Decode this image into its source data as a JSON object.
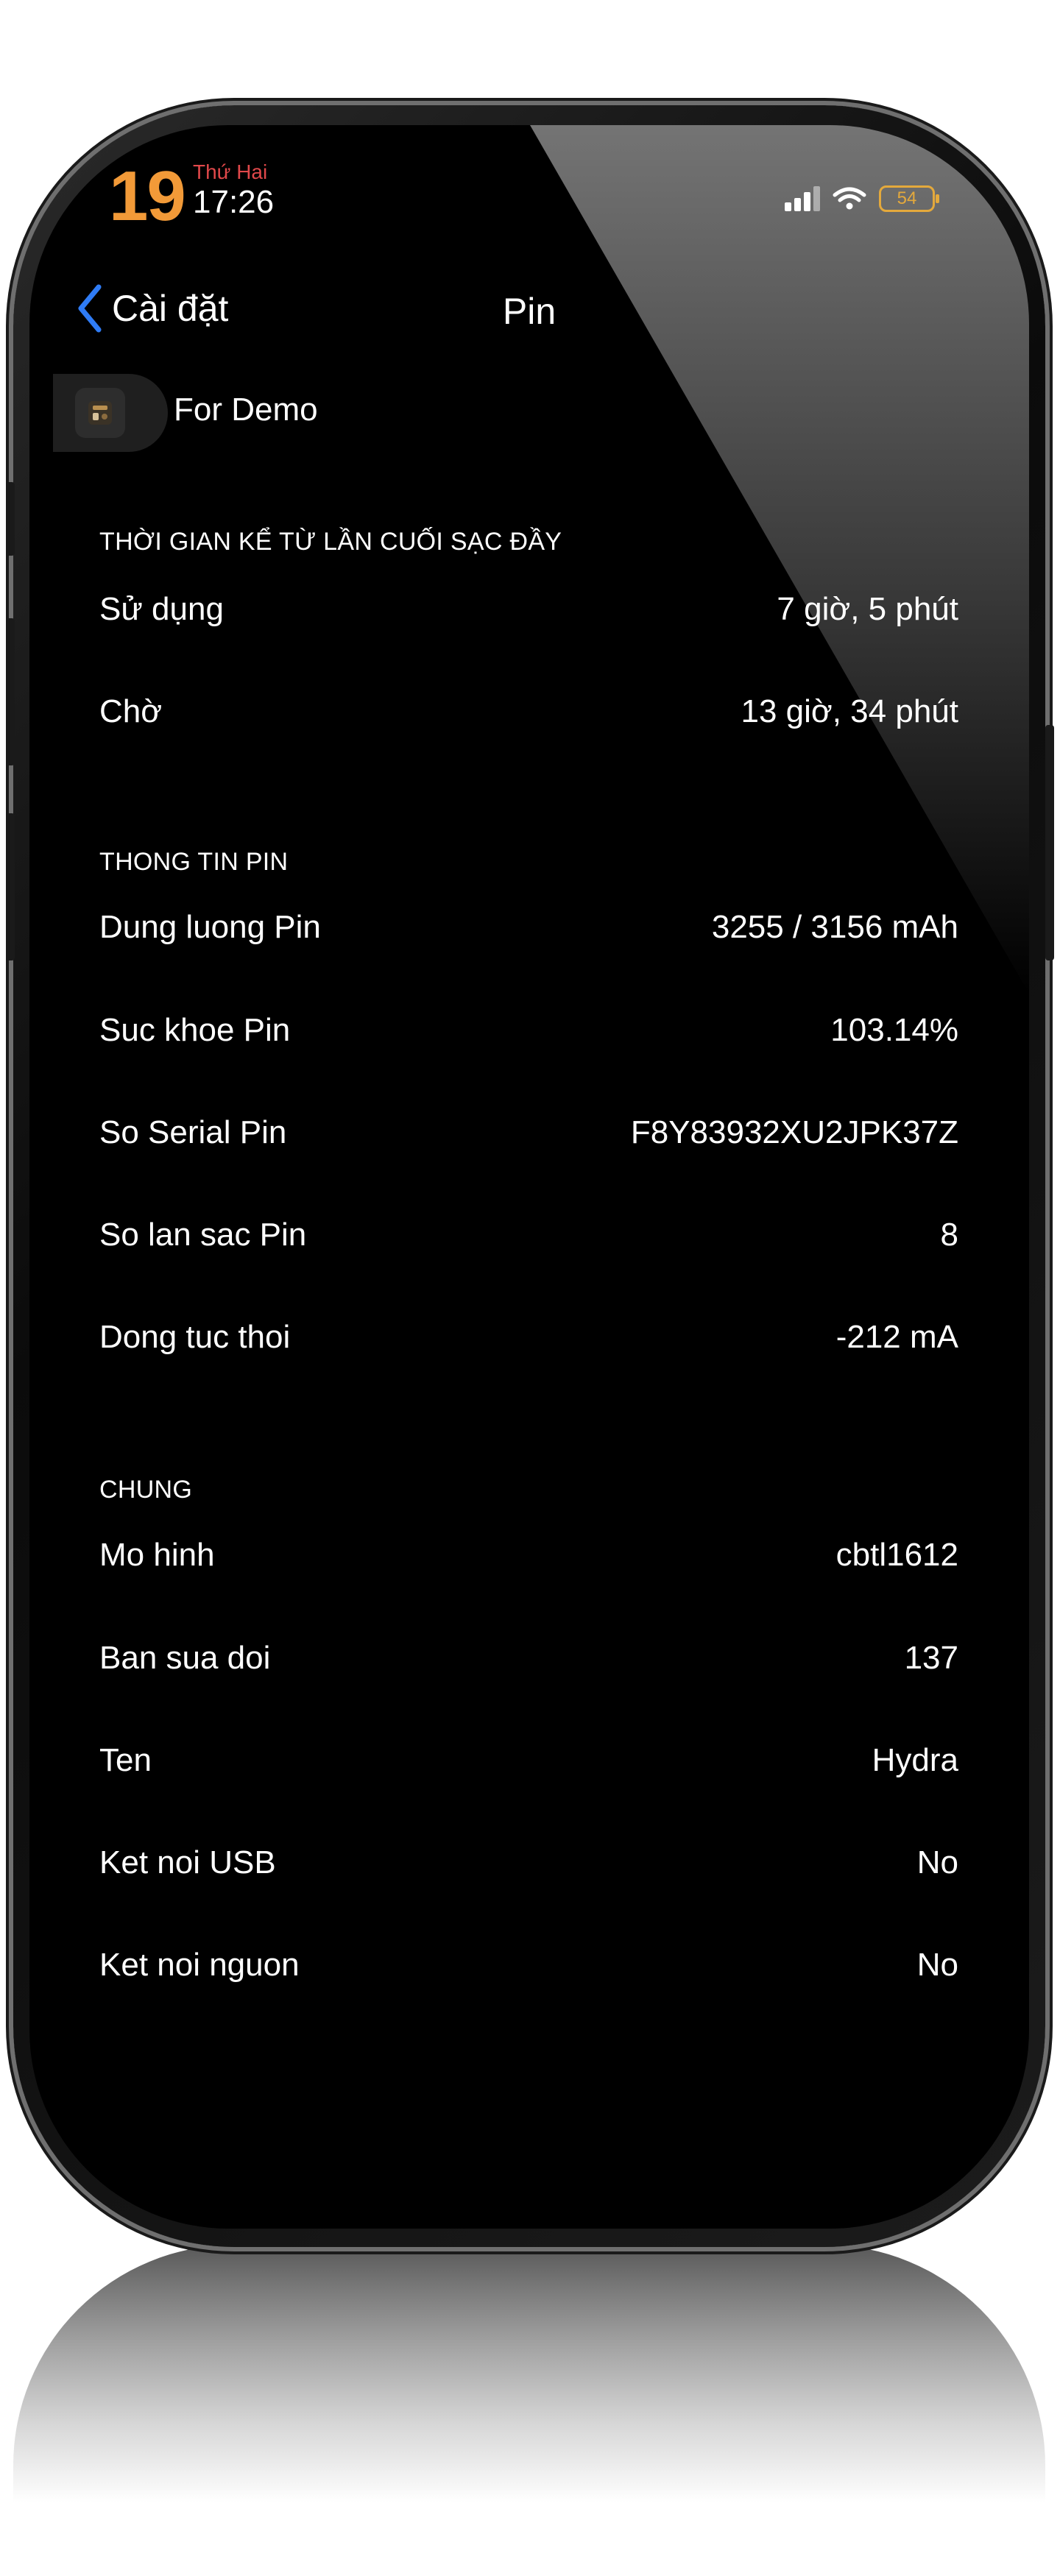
{
  "status_bar": {
    "day_number": "19",
    "weekday": "Thứ Hai",
    "time": "17:26",
    "battery_level": "54",
    "signal_icon": "cellular-signal-icon",
    "wifi_icon": "wifi-icon",
    "battery_icon": "battery-icon"
  },
  "nav": {
    "back_label": "Cài đặt",
    "title": "Pin"
  },
  "banner": {
    "label": "For Demo"
  },
  "sections": {
    "usage": {
      "header": "THỜI GIAN KỂ TỪ LẦN CUỐI SẠC ĐẦY",
      "rows": [
        {
          "label": "Sử dụng",
          "value": "7 giờ, 5 phút"
        },
        {
          "label": "Chờ",
          "value": "13 giờ, 34 phút"
        }
      ]
    },
    "battery_info": {
      "header": "THONG TIN PIN",
      "rows": [
        {
          "label": "Dung luong Pin",
          "value": "3255 / 3156 mAh"
        },
        {
          "label": "Suc khoe Pin",
          "value": "103.14%"
        },
        {
          "label": "So Serial Pin",
          "value": "F8Y83932XU2JPK37Z"
        },
        {
          "label": "So lan sac Pin",
          "value": "8"
        },
        {
          "label": "Dong tuc thoi",
          "value": "-212 mA"
        }
      ]
    },
    "general": {
      "header": "CHUNG",
      "rows": [
        {
          "label": "Mo hinh",
          "value": "cbtl1612"
        },
        {
          "label": "Ban sua doi",
          "value": "137"
        },
        {
          "label": "Ten",
          "value": "Hydra"
        },
        {
          "label": "Ket noi USB",
          "value": "No"
        },
        {
          "label": "Ket noi nguon",
          "value": "No"
        }
      ]
    }
  },
  "colors": {
    "accent_blue": "#2f7cf6",
    "date_orange": "#f29a38",
    "weekday_red": "#e0484a",
    "battery_yellow": "#e4a93c"
  }
}
